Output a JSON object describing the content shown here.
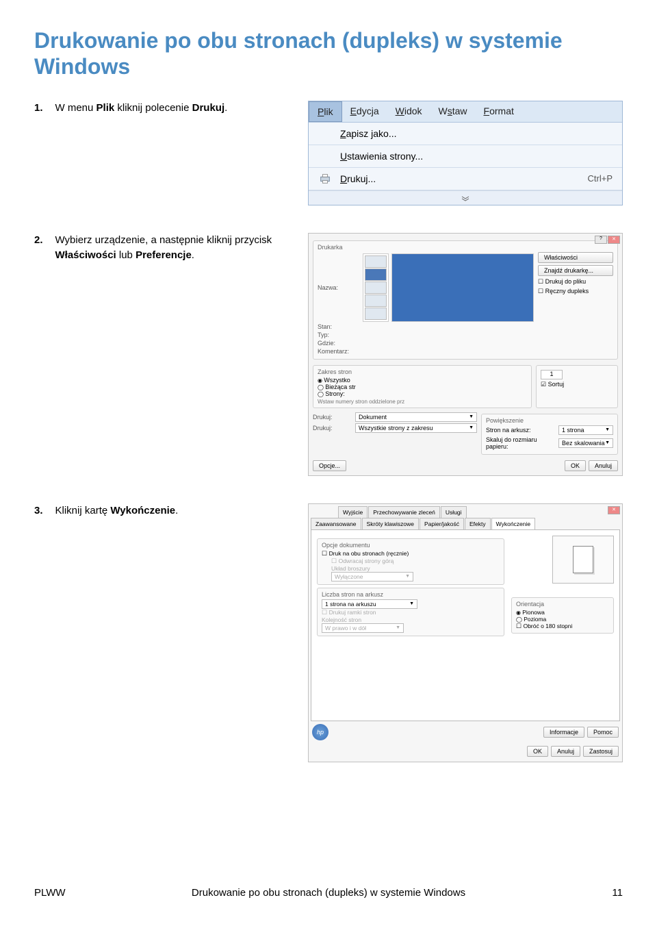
{
  "heading": "Drukowanie po obu stronach (dupleks) w systemie Windows",
  "steps": {
    "s1": {
      "num": "1.",
      "pre": "W menu ",
      "b1": "Plik",
      "mid": " kliknij polecenie ",
      "b2": "Drukuj",
      "post": "."
    },
    "s2": {
      "num": "2.",
      "pre": "Wybierz urządzenie, a następnie kliknij przycisk ",
      "b1": "Właściwości",
      "mid": " lub ",
      "b2": "Preferencje",
      "post": "."
    },
    "s3": {
      "num": "3.",
      "pre": "Kliknij kartę ",
      "b1": "Wykończenie",
      "post": "."
    }
  },
  "menu": {
    "tabs": {
      "plik": "Plik",
      "edycja": "Edycja",
      "widok": "Widok",
      "wstaw": "Wstaw",
      "format": "Format"
    },
    "items": {
      "zapisz": "Zapisz jako...",
      "ustawienia": "Ustawienia strony...",
      "drukuj": "Drukuj...",
      "drukuj_shortcut": "Ctrl+P"
    }
  },
  "printdlg": {
    "grp_drukarka": "Drukarka",
    "nazwa": "Nazwa:",
    "stan": "Stan:",
    "typ": "Typ:",
    "gdzie": "Gdzie:",
    "komentarz": "Komentarz:",
    "btn_wlasc": "Właściwości",
    "btn_znajdz": "Znajdź drukarkę...",
    "chk_doplfku": "Drukuj do pliku",
    "chk_reczny": "Ręczny dupleks",
    "grp_zakres": "Zakres stron",
    "r_wszystko": "Wszystko",
    "r_biezaca": "Bieżąca str",
    "r_strony": "Strony:",
    "zakres_hint": "Wstaw numery stron oddzielone prz",
    "l_drukuj": "Drukuj:",
    "v_drukuj": "Dokument",
    "l_drukuj2": "Drukuj:",
    "v_drukuj2": "Wszystkie strony z zakresu",
    "grp_pow": "Powiększenie",
    "l_stron": "Stron na arkusz:",
    "v_stron": "1 strona",
    "l_skaluj": "Skaluj do rozmiaru papieru:",
    "v_skaluj": "Bez skalowania",
    "spin_val": "1",
    "chk_sortuj": "Sortuj",
    "btn_opcje": "Opcje...",
    "btn_ok": "OK",
    "btn_anuluj": "Anuluj"
  },
  "propdlg": {
    "tabs_row1": {
      "wyjscie": "Wyjście",
      "przech": "Przechowywanie zleceń",
      "uslugi": "Usługi"
    },
    "tabs_row2": {
      "zaaw": "Zaawansowane",
      "skroty": "Skróty klawiszowe",
      "papier": "Papier/jakość",
      "efekty": "Efekty",
      "wykon": "Wykończenie"
    },
    "grp_opcje": "Opcje dokumentu",
    "chk_druk2": "Druk na obu stronach (ręcznie)",
    "chk_odwr": "Odwracaj strony górą",
    "lbl_uklad": "Układ broszury",
    "combo_wyl": "Wyłączone",
    "lbl_liczba": "Liczba stron na arkusz",
    "combo_1str": "1 strona na arkuszu",
    "chk_ramki": "Drukuj ramki stron",
    "lbl_kolejnosc": "Kolejność stron",
    "combo_wprawo": "W prawo i w dół",
    "grp_orient": "Orientacja",
    "r_pion": "Pionowa",
    "r_pozioma": "Pozioma",
    "chk_obrot": "Obróć o 180 stopni",
    "btn_info": "Informacje",
    "btn_pomoc": "Pomoc",
    "btn_ok": "OK",
    "btn_anuluj": "Anuluj",
    "btn_zastosuj": "Zastosuj",
    "hp": "hp"
  },
  "footer": {
    "left": "PLWW",
    "center": "Drukowanie po obu stronach (dupleks) w systemie Windows",
    "right": "11"
  }
}
